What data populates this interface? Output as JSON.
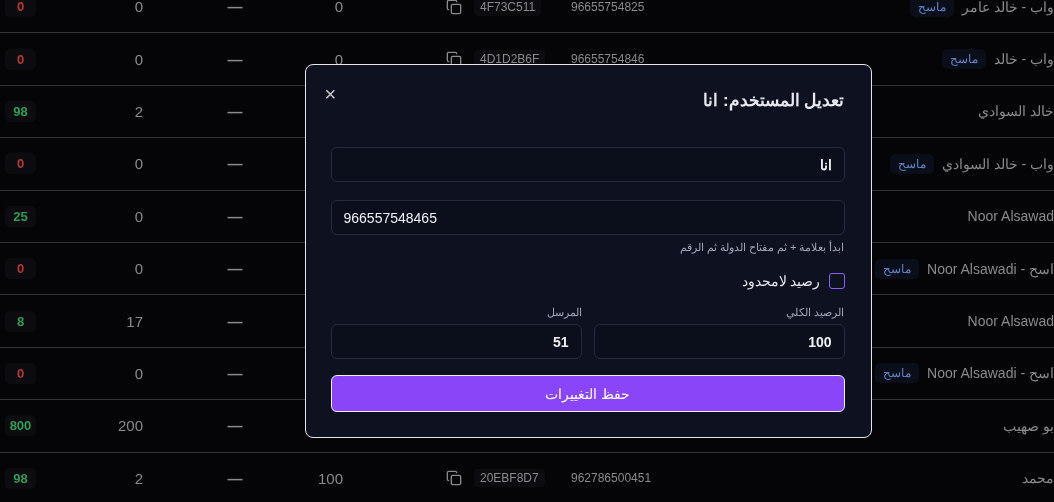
{
  "table": {
    "rows": [
      {
        "balance": "0",
        "color": "#b83838",
        "sent": "0",
        "dash": "—",
        "total": "0",
        "code": "4F73C511",
        "phone": "96655754825",
        "name": "واب - خالد عامر",
        "tag": "ماسح"
      },
      {
        "balance": "0",
        "color": "#b83838",
        "sent": "0",
        "dash": "—",
        "total": "0",
        "code": "4D1D2B6F",
        "phone": "96655754846",
        "name": "واب - خالد",
        "tag": "ماسح"
      },
      {
        "balance": "98",
        "color": "#2e9c55",
        "sent": "2",
        "dash": "—",
        "name": "خالد السوادي"
      },
      {
        "balance": "0",
        "color": "#b83838",
        "sent": "0",
        "dash": "—",
        "name": "واب - خالد السوادي",
        "tag": "ماسح"
      },
      {
        "balance": "25",
        "color": "#2e9c55",
        "sent": "0",
        "dash": "—",
        "name": "Noor Alsawad"
      },
      {
        "balance": "0",
        "color": "#b83838",
        "sent": "0",
        "dash": "—",
        "name": "اسح - Noor Alsawadi",
        "tag": "ماسح"
      },
      {
        "balance": "8",
        "color": "#2e9c55",
        "sent": "17",
        "dash": "—",
        "name": "Noor Alsawad"
      },
      {
        "balance": "0",
        "color": "#b83838",
        "sent": "0",
        "dash": "—",
        "name": "اسح - Noor Alsawadi",
        "tag": "ماسح"
      },
      {
        "balance": "800",
        "color": "#2e9c55",
        "sent": "200",
        "dash": "—",
        "name": "بو صهيب"
      },
      {
        "balance": "98",
        "color": "#2e9c55",
        "sent": "2",
        "dash": "—",
        "total": "100",
        "code": "20EBF8D7",
        "phone": "962786500451",
        "name": "محمد"
      }
    ]
  },
  "dialog": {
    "title": "تعديل المستخدم: انا",
    "close": "×",
    "name_value": "انا",
    "phone_value": "966557548465",
    "phone_hint": "ابدأ بعلامة + ثم مفتاح الدولة ثم الرقم",
    "unlimited": {
      "label": "رصيد لامحدود",
      "checked": false
    },
    "total_label": "الرصيد الكلي",
    "total_value": "100",
    "sent_label": "المرسل",
    "sent_value": "51",
    "save": "حفظ التغييرات"
  }
}
